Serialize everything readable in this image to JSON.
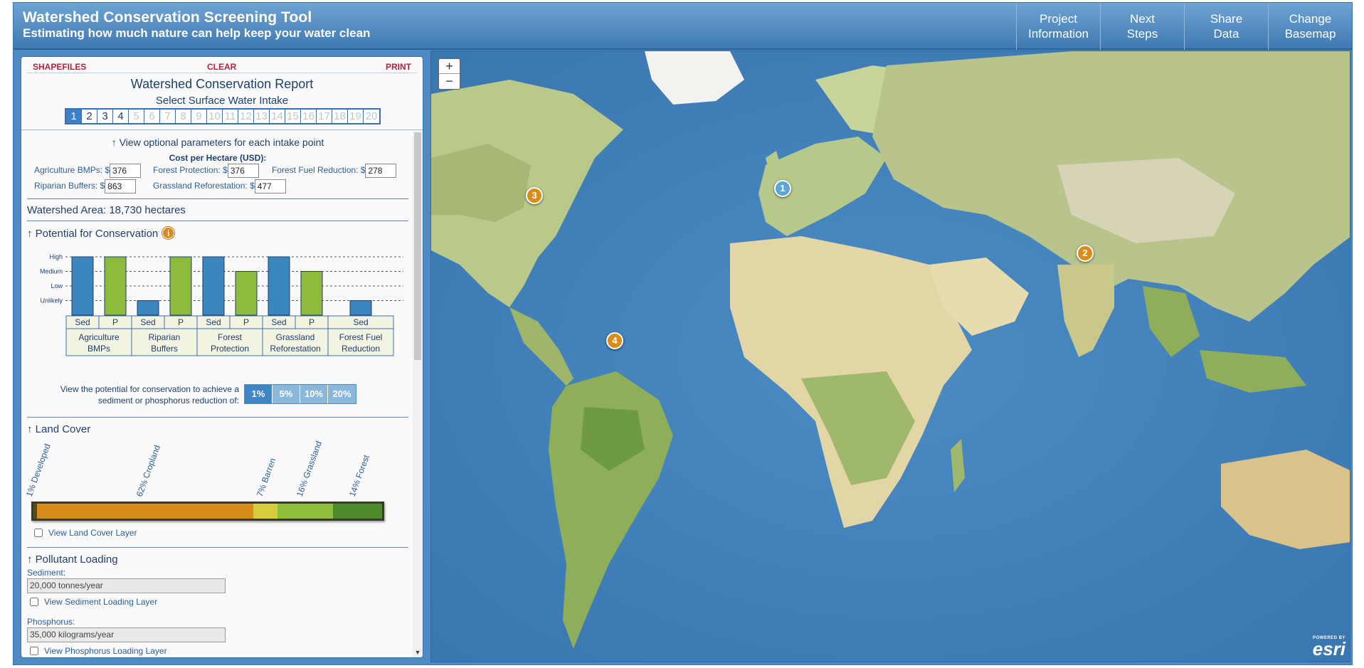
{
  "header": {
    "title": "Watershed Conservation Screening Tool",
    "subtitle": "Estimating how much nature can help keep your water clean",
    "nav": [
      {
        "label": "Project\nInformation"
      },
      {
        "label": "Next\nSteps"
      },
      {
        "label": "Share\nData"
      },
      {
        "label": "Change\nBasemap"
      }
    ]
  },
  "panel": {
    "toolbar": {
      "shapefiles": "SHAPEFILES",
      "clear": "CLEAR",
      "print": "PRINT"
    },
    "report_title": "Watershed Conservation Report",
    "intake_label": "Select Surface Water Intake",
    "intakes": [
      "1",
      "2",
      "3",
      "4",
      "5",
      "6",
      "7",
      "8",
      "9",
      "10",
      "11",
      "12",
      "13",
      "14",
      "15",
      "16",
      "17",
      "18",
      "19",
      "20"
    ],
    "intake_selected": "1",
    "intake_enabled_count": 4,
    "optional_link": "↑ View optional parameters for each intake point",
    "cost_title": "Cost per Hectare (USD):",
    "costs": {
      "agriculture_label": "Agriculture BMPs: $",
      "agriculture_value": "376",
      "forest_protection_label": "Forest Protection: $",
      "forest_protection_value": "376",
      "forest_fuel_label": "Forest Fuel Reduction: $",
      "forest_fuel_value": "278",
      "riparian_label": "Riparian Buffers:  $",
      "riparian_value": "863",
      "grassland_label": "Grassland Reforestation: $",
      "grassland_value": "477"
    },
    "watershed_area": "Watershed Area: 18,730 hectares",
    "potential_heading": "↑ Potential for Conservation",
    "info_icon": "i",
    "reduction_text": "View the potential for conservation to achieve a sediment or phosphorus reduction of:",
    "reduction_options": [
      "1%",
      "5%",
      "10%",
      "20%"
    ],
    "reduction_selected": "1%",
    "land_cover_heading": "↑ Land Cover",
    "land_cover_layer": "View Land Cover Layer",
    "pollutant_heading": "↑ Pollutant Loading",
    "sediment_label": "Sediment:",
    "sediment_value": "20,000 tonnes/year",
    "sediment_layer": "View Sediment Loading Layer",
    "phosphorus_label": "Phosphorus:",
    "phosphorus_value": "35,000 kilograms/year",
    "phosphorus_layer": "View Phosphorus Loading Layer"
  },
  "chart_data": {
    "type": "bar",
    "title": "",
    "levels": [
      "Unlikely",
      "Low",
      "Medium",
      "High"
    ],
    "groups": [
      {
        "name": "Agriculture BMPs",
        "bars": [
          {
            "label": "Sed",
            "level": 4,
            "color": "#3c86bf"
          },
          {
            "label": "P",
            "level": 4,
            "color": "#8dbb3c"
          }
        ]
      },
      {
        "name": "Riparian Buffers",
        "bars": [
          {
            "label": "Sed",
            "level": 1,
            "color": "#3c86bf"
          },
          {
            "label": "P",
            "level": 4,
            "color": "#8dbb3c"
          }
        ]
      },
      {
        "name": "Forest Protection",
        "bars": [
          {
            "label": "Sed",
            "level": 4,
            "color": "#3c86bf"
          },
          {
            "label": "P",
            "level": 3,
            "color": "#8dbb3c"
          }
        ]
      },
      {
        "name": "Grassland Reforestation",
        "bars": [
          {
            "label": "Sed",
            "level": 4,
            "color": "#3c86bf"
          },
          {
            "label": "P",
            "level": 3,
            "color": "#8dbb3c"
          }
        ]
      },
      {
        "name": "Forest Fuel Reduction",
        "bars": [
          {
            "label": "Sed",
            "level": 1,
            "color": "#3c86bf"
          }
        ]
      }
    ],
    "group_labels": [
      [
        "Agriculture",
        "BMPs"
      ],
      [
        "Riparian",
        "Buffers"
      ],
      [
        "Forest",
        "Protection"
      ],
      [
        "Grassland",
        "Reforestation"
      ],
      [
        "Forest Fuel",
        "Reduction"
      ]
    ]
  },
  "land_cover": [
    {
      "label": "1% Developed",
      "percent": 1,
      "color": "#5a4a1e"
    },
    {
      "label": "62% Cropland",
      "percent": 62,
      "color": "#d98c1a"
    },
    {
      "label": "7% Barren",
      "percent": 7,
      "color": "#d9cc3a"
    },
    {
      "label": "16% Grassland",
      "percent": 16,
      "color": "#8fbf3a"
    },
    {
      "label": "14% Forest",
      "percent": 14,
      "color": "#4e8a2a"
    }
  ],
  "map": {
    "zoom_in": "+",
    "zoom_out": "−",
    "markers": [
      {
        "label": "1",
        "color": "#5aa6d6"
      },
      {
        "label": "2",
        "color": "#d98c1a"
      },
      {
        "label": "3",
        "color": "#d98c1a"
      },
      {
        "label": "4",
        "color": "#d98c1a"
      }
    ],
    "attribution_small": "POWERED BY",
    "attribution_logo": "esri"
  }
}
